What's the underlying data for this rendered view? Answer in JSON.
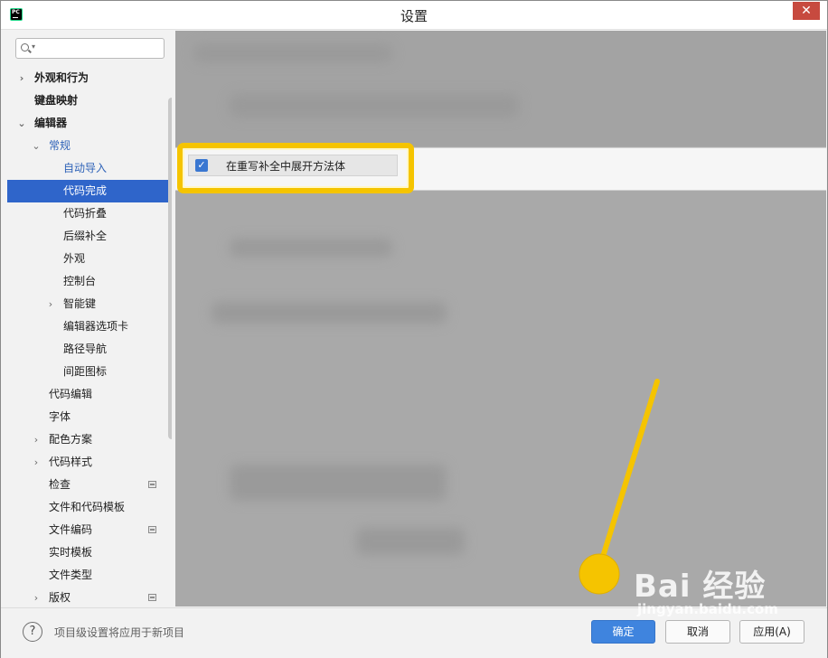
{
  "window": {
    "title": "设置",
    "close_glyph": "✕"
  },
  "search": {
    "placeholder": ""
  },
  "sidebar": {
    "items": [
      {
        "label": "外观和行为",
        "level": 0,
        "chevron": "›",
        "bold": true
      },
      {
        "label": "键盘映射",
        "level": 0,
        "chevron": "",
        "bold": true
      },
      {
        "label": "编辑器",
        "level": 0,
        "chevron": "⌄",
        "bold": true
      },
      {
        "label": "常规",
        "level": 1,
        "chevron": "⌄",
        "blue": true
      },
      {
        "label": "自动导入",
        "level": 2,
        "chevron": "",
        "blue": true
      },
      {
        "label": "代码完成",
        "level": 2,
        "chevron": "",
        "selected": true
      },
      {
        "label": "代码折叠",
        "level": 2,
        "chevron": ""
      },
      {
        "label": "后缀补全",
        "level": 2,
        "chevron": ""
      },
      {
        "label": "外观",
        "level": 2,
        "chevron": ""
      },
      {
        "label": "控制台",
        "level": 2,
        "chevron": ""
      },
      {
        "label": "智能键",
        "level": 2,
        "chevron": "›"
      },
      {
        "label": "编辑器选项卡",
        "level": 2,
        "chevron": ""
      },
      {
        "label": "路径导航",
        "level": 2,
        "chevron": ""
      },
      {
        "label": "间距图标",
        "level": 2,
        "chevron": ""
      },
      {
        "label": "代码编辑",
        "level": 1,
        "chevron": ""
      },
      {
        "label": "字体",
        "level": 1,
        "chevron": ""
      },
      {
        "label": "配色方案",
        "level": 1,
        "chevron": "›"
      },
      {
        "label": "代码样式",
        "level": 1,
        "chevron": "›"
      },
      {
        "label": "检查",
        "level": 1,
        "chevron": "",
        "project_icon": true
      },
      {
        "label": "文件和代码模板",
        "level": 1,
        "chevron": ""
      },
      {
        "label": "文件编码",
        "level": 1,
        "chevron": "",
        "project_icon": true
      },
      {
        "label": "实时模板",
        "level": 1,
        "chevron": ""
      },
      {
        "label": "文件类型",
        "level": 1,
        "chevron": ""
      },
      {
        "label": "版权",
        "level": 1,
        "chevron": "›",
        "project_icon": true
      }
    ]
  },
  "content": {
    "option_label": "在重写补全中展开方法体",
    "option_checked": true,
    "check_glyph": "✓"
  },
  "footer": {
    "help_glyph": "?",
    "note": "项目级设置将应用于新项目",
    "ok_label": "确定",
    "cancel_label": "取消",
    "apply_label": "应用(A)"
  },
  "watermark": {
    "main": "Bai 经验",
    "sub": "jingyan.baidu.com"
  },
  "colors": {
    "selection": "#2f65ca",
    "highlight": "#f5c400",
    "primary_button": "#3f84de",
    "link_blue": "#2f63b8"
  }
}
